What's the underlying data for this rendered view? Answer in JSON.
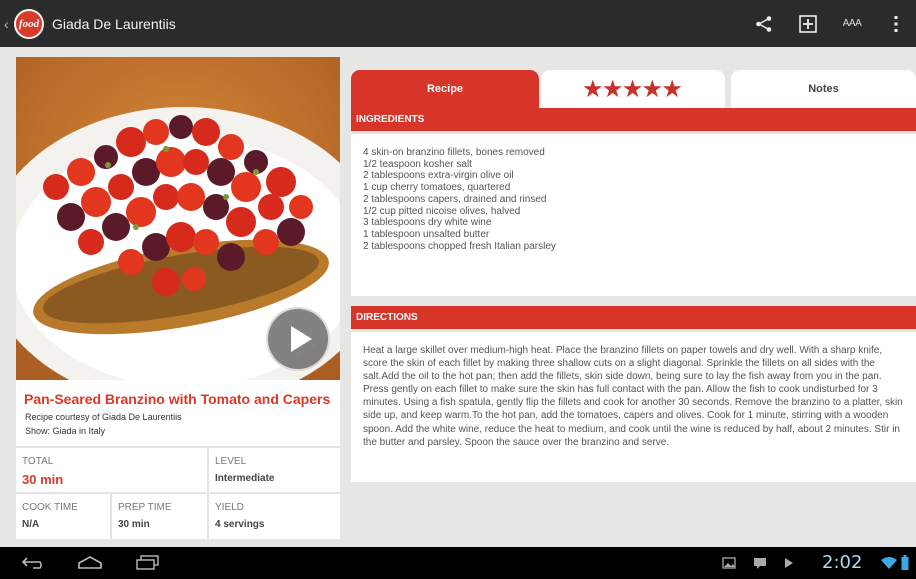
{
  "app": {
    "logo_text": "food",
    "title": "Giada De Laurentiis"
  },
  "actionbar": {
    "icons": [
      "share-icon",
      "add-box-icon",
      "text-size-icon",
      "overflow-menu-icon"
    ],
    "text_size_label": "AAA"
  },
  "recipe": {
    "title": "Pan-Seared Branzino with Tomato and Capers",
    "credit": "Recipe courtesy of Giada De Laurentiis",
    "show": "Show: Giada in Italy"
  },
  "info": {
    "total_label": "TOTAL",
    "total_value": "30 min",
    "level_label": "LEVEL",
    "level_value": "Intermediate",
    "cook_label": "COOK TIME",
    "cook_value": "N/A",
    "prep_label": "PREP TIME",
    "prep_value": "30 min",
    "yield_label": "YIELD",
    "yield_value": "4 servings"
  },
  "tabs": {
    "recipe": "Recipe",
    "rating": "★★★★★",
    "notes": "Notes"
  },
  "ingredients": {
    "header": "INGREDIENTS",
    "items": [
      "4 skin-on branzino fillets, bones removed",
      "1/2 teaspoon kosher salt",
      "2 tablespoons extra-virgin olive oil",
      "1 cup cherry tomatoes, quartered",
      "2 tablespoons capers, drained and rinsed",
      "1/2 cup pitted nicoise olives, halved",
      "3 tablespoons dry white wine",
      "1 tablespoon unsalted butter",
      "2 tablespoons chopped fresh Italian parsley"
    ]
  },
  "directions": {
    "header": "DIRECTIONS",
    "text": "Heat a large skillet over medium-high heat. Place the branzino fillets on paper towels and dry well. With a sharp knife, score the skin of each fillet by making three shallow cuts on a slight diagonal. Sprinkle the fillets on all sides with the salt.Add the oil to the hot pan; then add the fillets, skin side down, being sure to lay the fish away from you in the pan. Press gently on each fillet to make sure the skin has full contact with the pan. Allow the fish to cook undisturbed for 3 minutes. Using a fish spatula, gently flip the fillets and cook for another 30 seconds. Remove the branzino to a platter, skin side up, and keep warm.To the hot pan, add the tomatoes, capers and olives. Cook for 1 minute, stirring with a wooden spoon. Add the white wine, reduce the heat to medium, and cook until the wine is reduced by half, about 2 minutes. Stir in the butter and parsley. Spoon the sauce over the branzino and serve."
  },
  "system": {
    "time": "2:02",
    "accent": "#aed9f3"
  },
  "colors": {
    "brand_red": "#d7342a",
    "actionbar": "#2b2b2b"
  }
}
